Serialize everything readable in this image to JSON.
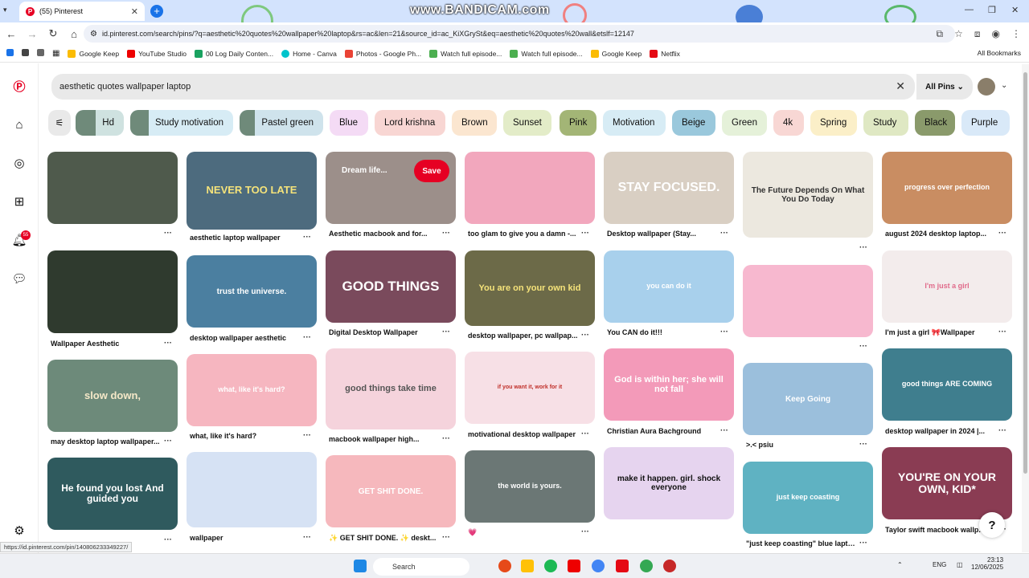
{
  "browser": {
    "tab_title": "(55) Pinterest",
    "url_scheme": "id.pinterest.com",
    "url": "id.pinterest.com/search/pins/?q=aesthetic%20quotes%20wallpaper%20laptop&rs=ac&len=21&source_id=ac_KiXGrySt&eq=aesthetic%20quotes%20wall&etslf=12147",
    "watermark": "www.BANDICAM.com",
    "bookmarks": [
      "Google Keep",
      "YouTube Studio",
      "00 Log Daily Conten...",
      "Home - Canva",
      "Photos - Google Ph...",
      "Watch full episode...",
      "Watch full episode...",
      "Google Keep",
      "Netflix"
    ],
    "all_bookmarks": "All Bookmarks",
    "status_url": "https://id.pinterest.com/pin/140806233349227/"
  },
  "sidebar": {
    "notification_count": "55"
  },
  "search": {
    "query": "aesthetic quotes wallpaper laptop",
    "scope": "All Pins"
  },
  "chips": [
    "Hd",
    "Study motivation",
    "Pastel green",
    "Blue",
    "Lord krishna",
    "Brown",
    "Sunset",
    "Pink",
    "Motivation",
    "Beige",
    "Green",
    "4k",
    "Spring",
    "Study",
    "Black",
    "Purple"
  ],
  "pins": [
    {
      "caption": "",
      "text": ""
    },
    {
      "caption": "aesthetic laptop wallpaper",
      "text": "NEVER TOO LATE"
    },
    {
      "caption": "Aesthetic macbook and for...",
      "text": "",
      "hover_title": "Dream life...",
      "save": "Save"
    },
    {
      "caption": "too glam to give you a damn -...",
      "text": ""
    },
    {
      "caption": "Desktop wallpaper (Stay...",
      "text": "STAY FOCUSED."
    },
    {
      "caption": "",
      "text": "The Future Depends On What You Do Today"
    },
    {
      "caption": "august 2024 desktop laptop...",
      "text": "progress over perfection"
    },
    {
      "caption": "Wallpaper Aesthetic",
      "text": ""
    },
    {
      "caption": "desktop wallpaper aesthetic",
      "text": "trust the universe."
    },
    {
      "caption": "Digital Desktop Wallpaper",
      "text": "GOOD THINGS"
    },
    {
      "caption": "desktop wallpaper, pc wallpap...",
      "text": "You are on your own kid"
    },
    {
      "caption": "You CAN do it!!!",
      "text": "you can do it"
    },
    {
      "caption": "",
      "text": ""
    },
    {
      "caption": "I'm just a girl 🎀Wallpaper",
      "text": "I'm just a girl"
    },
    {
      "caption": "may desktop laptop wallpaper...",
      "text": "slow down,"
    },
    {
      "caption": "what, like it's hard?",
      "text": "what, like it's hard?"
    },
    {
      "caption": "macbook wallpaper high...",
      "text": "good things take time"
    },
    {
      "caption": "motivational desktop wallpaper",
      "text": "if you want it, work for it"
    },
    {
      "caption": "Christian Aura Bachground",
      "text": "God is within her; she will not fall"
    },
    {
      "caption": ">.< psiu",
      "text": "Keep Going"
    },
    {
      "caption": "desktop wallpaper in 2024 |...",
      "text": "good things ARE COMING"
    },
    {
      "caption": "",
      "text": "He found you lost And guided you"
    },
    {
      "caption": "wallpaper",
      "text": ""
    },
    {
      "caption": "✨ GET SHIT DONE. ✨ deskt...",
      "text": "GET SHIT DONE."
    },
    {
      "caption": "💗",
      "text": "the world is yours."
    },
    {
      "caption": "",
      "text": "make it happen. girl. shock everyone"
    },
    {
      "caption": "\"just keep coasting\" blue lapto...",
      "text": "just keep coasting"
    },
    {
      "caption": "Taylor swift macbook wallp...",
      "text": "YOU'RE ON YOUR OWN, KID*"
    }
  ],
  "taskbar": {
    "search": "Search",
    "lang": "ENG",
    "time": "23:13",
    "date": "12/06/2025"
  },
  "colors": {
    "pinterest_red": "#e60023",
    "tabstrip": "#d3e3fd"
  }
}
